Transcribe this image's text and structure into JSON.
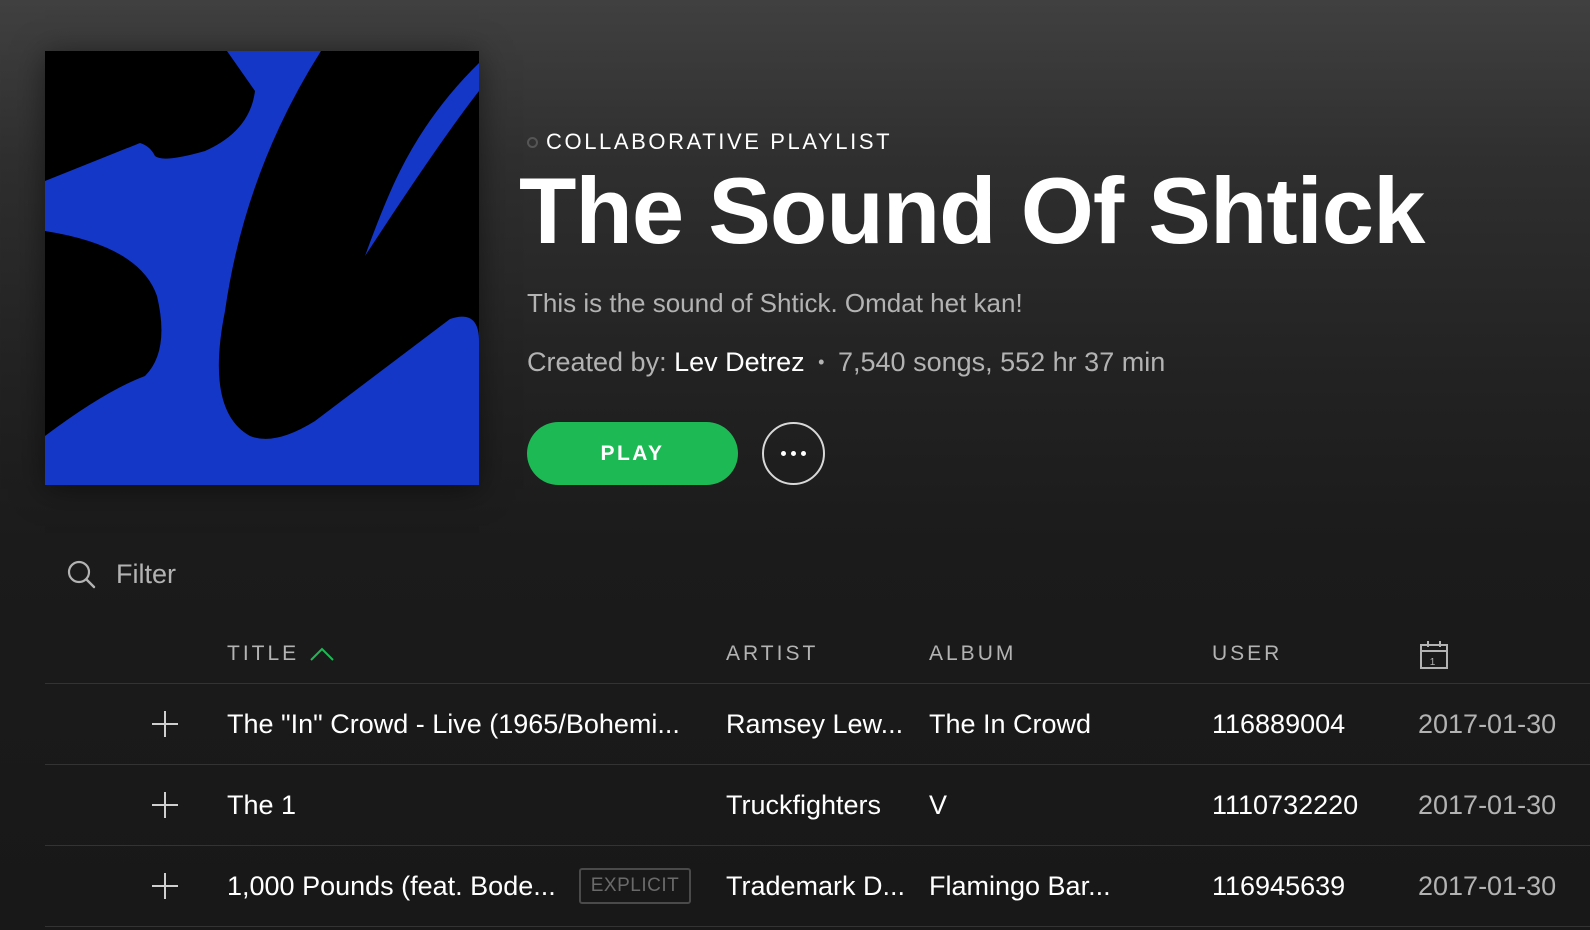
{
  "playlist": {
    "type_label": "COLLABORATIVE PLAYLIST",
    "title": "The Sound Of Shtick",
    "description": "This is the sound of Shtick. Omdat het kan!",
    "created_by_label": "Created by:",
    "owner": "Lev Detrez",
    "separator": "•",
    "stats": "7,540 songs, 552 hr 37 min",
    "cover_colors": {
      "primary": "#1437c8",
      "background": "#000000"
    }
  },
  "actions": {
    "play_label": "PLAY",
    "more_icon": "ellipsis-icon"
  },
  "filter": {
    "placeholder": "Filter",
    "icon": "search-icon"
  },
  "columns": {
    "title": "TITLE",
    "artist": "ARTIST",
    "album": "ALBUM",
    "user": "USER",
    "date_icon": "calendar-icon",
    "sort_icon": "chevron-up-icon"
  },
  "tracks": [
    {
      "title": "The \"In\" Crowd - Live (1965/Bohemi...",
      "explicit": false,
      "artist": "Ramsey Lew...",
      "album": "The In Crowd",
      "user": "116889004",
      "date": "2017-01-30"
    },
    {
      "title": "The 1",
      "explicit": false,
      "artist": "Truckfighters",
      "album": "V",
      "user": "1110732220",
      "date": "2017-01-30"
    },
    {
      "title": "1,000 Pounds (feat. Bode...",
      "explicit": true,
      "explicit_label": "EXPLICIT",
      "artist": "Trademark D...",
      "album": "Flamingo Bar...",
      "user": "116945639",
      "date": "2017-01-30"
    }
  ],
  "colors": {
    "accent": "#1db954",
    "text_primary": "#ffffff",
    "text_secondary": "#b3b3b3",
    "background": "#181818"
  }
}
